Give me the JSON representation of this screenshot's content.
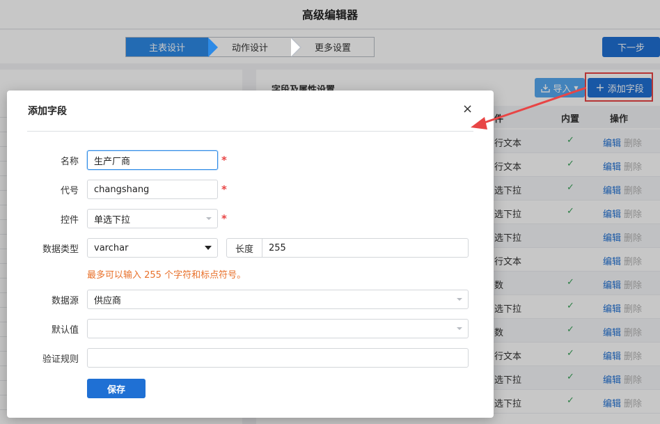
{
  "app": {
    "title": "高级编辑器",
    "steps": [
      "主表设计",
      "动作设计",
      "更多设置"
    ],
    "next_label": "下一步"
  },
  "fields_panel": {
    "title": "字段及属性设置",
    "import_label": "导入",
    "add_field_label": "添加字段",
    "columns": [
      "件",
      "内置",
      "操作"
    ],
    "rows": [
      {
        "control": "行文本",
        "builtin": "✓",
        "edit": "编辑",
        "delete": "删除"
      },
      {
        "control": "行文本",
        "builtin": "✓",
        "edit": "编辑",
        "delete": "删除"
      },
      {
        "control": "选下拉",
        "builtin": "✓",
        "edit": "编辑",
        "delete": "删除"
      },
      {
        "control": "选下拉",
        "builtin": "✓",
        "edit": "编辑",
        "delete": "删除"
      },
      {
        "control": "选下拉",
        "builtin": "",
        "edit": "编辑",
        "delete": "删除"
      },
      {
        "control": "行文本",
        "builtin": "",
        "edit": "编辑",
        "delete": "删除"
      },
      {
        "control": "数",
        "builtin": "✓",
        "edit": "编辑",
        "delete": "删除"
      },
      {
        "control": "选下拉",
        "builtin": "✓",
        "edit": "编辑",
        "delete": "删除"
      },
      {
        "control": "数",
        "builtin": "✓",
        "edit": "编辑",
        "delete": "删除"
      },
      {
        "control": "行文本",
        "builtin": "✓",
        "edit": "编辑",
        "delete": "删除"
      },
      {
        "control": "选下拉",
        "builtin": "✓",
        "edit": "编辑",
        "delete": "删除"
      },
      {
        "control": "选下拉",
        "builtin": "✓",
        "edit": "编辑",
        "delete": "删除"
      }
    ]
  },
  "modal": {
    "title": "添加字段",
    "close_icon": "×",
    "name_label": "名称",
    "name_value": "生产厂商",
    "code_label": "代号",
    "code_value": "changshang",
    "control_label": "控件",
    "control_value": "单选下拉",
    "datatype_label": "数据类型",
    "datatype_value": "varchar",
    "length_label": "长度",
    "length_value": "255",
    "hint": "最多可以输入 255 个字符和标点符号。",
    "datasource_label": "数据源",
    "datasource_value": "供应商",
    "default_label": "默认值",
    "default_value": "",
    "validation_label": "验证规则",
    "validation_value": "",
    "required_mark": "*",
    "save_label": "保存"
  },
  "colors": {
    "primary": "#1f70d4",
    "step_active": "#2d8ae6",
    "required": "#e84545",
    "hint": "#e8702a",
    "annotation": "#e84545"
  }
}
